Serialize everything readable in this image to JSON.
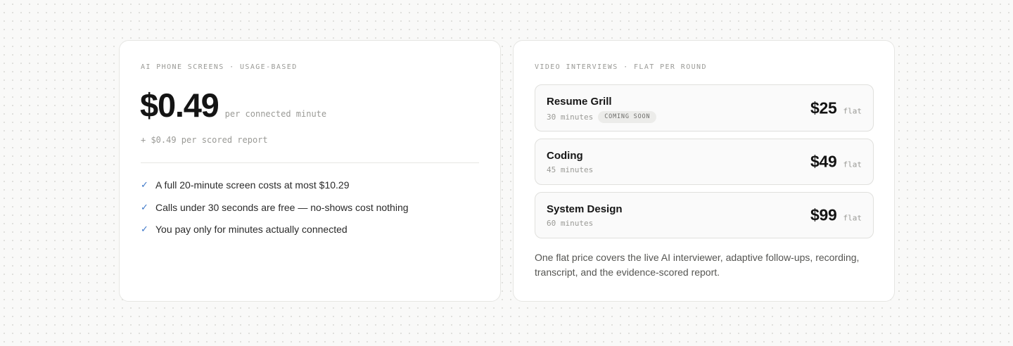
{
  "phone_card": {
    "eyebrow": "AI PHONE SCREENS · USAGE-BASED",
    "price": "$0.49",
    "price_unit": "per connected minute",
    "subprice": "+ $0.49 per scored report",
    "bullets": [
      "A full 20-minute screen costs at most $10.29",
      "Calls under 30 seconds are free — no-shows cost nothing",
      "You pay only for minutes actually connected"
    ],
    "check_glyph": "✓"
  },
  "video_card": {
    "eyebrow": "VIDEO INTERVIEWS · FLAT PER ROUND",
    "rounds": [
      {
        "name": "Resume Grill",
        "duration": "30 minutes",
        "badge": "COMING SOON",
        "price": "$25",
        "unit": "flat"
      },
      {
        "name": "Coding",
        "duration": "45 minutes",
        "price": "$49",
        "unit": "flat"
      },
      {
        "name": "System Design",
        "duration": "60 minutes",
        "price": "$99",
        "unit": "flat"
      }
    ],
    "footnote": "One flat price covers the live AI interviewer, adaptive follow-ups, recording, transcript, and the evidence-scored report."
  },
  "colors": {
    "accent_check": "#3d78c9",
    "text_primary": "#161616",
    "text_muted": "#9a9a96",
    "card_bg": "#ffffff",
    "page_bg": "#f9f9f8"
  }
}
